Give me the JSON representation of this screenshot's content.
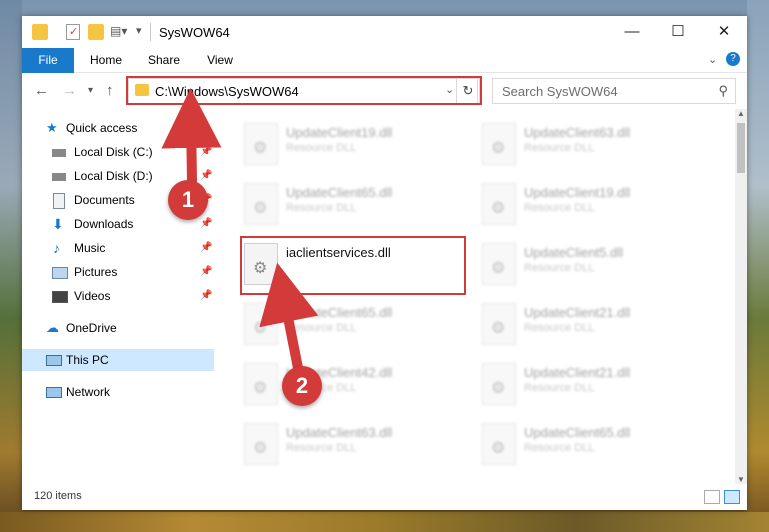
{
  "window": {
    "title": "SysWOW64"
  },
  "ribbon": {
    "tabs": [
      "File",
      "Home",
      "Share",
      "View"
    ]
  },
  "nav": {
    "address": "C:\\Windows\\SysWOW64",
    "search_placeholder": "Search SysWOW64"
  },
  "sidebar": {
    "items": [
      {
        "label": "Quick access",
        "icon": "star-icon"
      },
      {
        "label": "Local Disk (C:)",
        "icon": "drive-icon",
        "pinned": true
      },
      {
        "label": "Local Disk (D:)",
        "icon": "drive-icon",
        "pinned": true
      },
      {
        "label": "Documents",
        "icon": "documents-icon",
        "pinned": true
      },
      {
        "label": "Downloads",
        "icon": "download-icon",
        "pinned": true
      },
      {
        "label": "Music",
        "icon": "music-icon",
        "pinned": true
      },
      {
        "label": "Pictures",
        "icon": "pictures-icon",
        "pinned": true
      },
      {
        "label": "Videos",
        "icon": "videos-icon",
        "pinned": true
      },
      {
        "label": "OneDrive",
        "icon": "cloud-icon"
      },
      {
        "label": "This PC",
        "icon": "computer-icon",
        "selected": true
      },
      {
        "label": "Network",
        "icon": "network-icon"
      }
    ]
  },
  "files": {
    "left": [
      {
        "name": "UpdateClient19.dll",
        "type": "Resource DLL"
      },
      {
        "name": "UpdateClient65.dll",
        "type": "Resource DLL"
      },
      {
        "name": "iaclientservices.dll",
        "type": "",
        "highlighted": true
      },
      {
        "name": "UpdateClient65.dll",
        "type": "Resource DLL"
      },
      {
        "name": "UpdateClient42.dll",
        "type": "Resource DLL"
      },
      {
        "name": "UpdateClient63.dll",
        "type": "Resource DLL"
      }
    ],
    "right": [
      {
        "name": "UpdateClient63.dll",
        "type": "Resource DLL"
      },
      {
        "name": "UpdateClient19.dll",
        "type": "Resource DLL"
      },
      {
        "name": "UpdateClient5.dll",
        "type": "Resource DLL"
      },
      {
        "name": "UpdateClient21.dll",
        "type": "Resource DLL"
      },
      {
        "name": "UpdateClient21.dll",
        "type": "Resource DLL"
      },
      {
        "name": "UpdateClient65.dll",
        "type": "Resource DLL"
      }
    ]
  },
  "status": {
    "count": "120 items"
  },
  "annotations": {
    "step1": "1",
    "step2": "2",
    "color": "#d33a3a"
  }
}
